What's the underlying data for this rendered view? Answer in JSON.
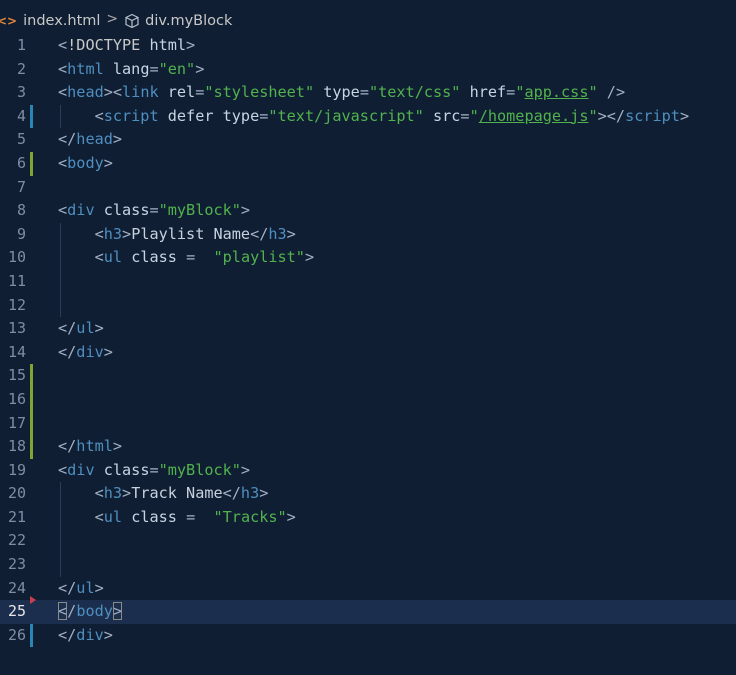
{
  "breadcrumb": {
    "file_icon": "<>",
    "file": "index.html",
    "separator": ">",
    "symbol": "div.myBlock"
  },
  "lines": [
    {
      "n": "1",
      "tokens": [
        [
          "punc",
          "<"
        ],
        [
          "doctype",
          "!DOCTYPE "
        ],
        [
          "attr",
          "html"
        ],
        [
          "punc",
          ">"
        ]
      ]
    },
    {
      "n": "2",
      "tokens": [
        [
          "punc",
          "<"
        ],
        [
          "tag",
          "html"
        ],
        [
          "text",
          " "
        ],
        [
          "attr",
          "lang"
        ],
        [
          "punc",
          "="
        ],
        [
          "str",
          "\"en\""
        ],
        [
          "punc",
          ">"
        ]
      ]
    },
    {
      "n": "3",
      "tokens": [
        [
          "punc",
          "<"
        ],
        [
          "tag",
          "head"
        ],
        [
          "punc",
          "><"
        ],
        [
          "tag",
          "link"
        ],
        [
          "text",
          " "
        ],
        [
          "attr",
          "rel"
        ],
        [
          "punc",
          "="
        ],
        [
          "str",
          "\"stylesheet\""
        ],
        [
          "text",
          " "
        ],
        [
          "attr",
          "type"
        ],
        [
          "punc",
          "="
        ],
        [
          "str",
          "\"text/css\""
        ],
        [
          "text",
          " "
        ],
        [
          "attr",
          "href"
        ],
        [
          "punc",
          "="
        ],
        [
          "str",
          "\""
        ],
        [
          "link",
          "app.css"
        ],
        [
          "str",
          "\""
        ],
        [
          "text",
          " "
        ],
        [
          "punc",
          "/>"
        ]
      ]
    },
    {
      "n": "4",
      "tokens": [
        [
          "text",
          "    "
        ],
        [
          "punc",
          "<"
        ],
        [
          "tag",
          "script"
        ],
        [
          "text",
          " "
        ],
        [
          "attr",
          "defer"
        ],
        [
          "text",
          " "
        ],
        [
          "attr",
          "type"
        ],
        [
          "punc",
          "="
        ],
        [
          "str",
          "\"text/javascript\""
        ],
        [
          "text",
          " "
        ],
        [
          "attr",
          "src"
        ],
        [
          "punc",
          "="
        ],
        [
          "str",
          "\""
        ],
        [
          "link",
          "/homepage.js"
        ],
        [
          "str",
          "\""
        ],
        [
          "punc",
          "></"
        ],
        [
          "tag",
          "script"
        ],
        [
          "punc",
          ">"
        ]
      ]
    },
    {
      "n": "5",
      "tokens": [
        [
          "punc",
          "</"
        ],
        [
          "tag",
          "head"
        ],
        [
          "punc",
          ">"
        ]
      ]
    },
    {
      "n": "6",
      "tokens": [
        [
          "punc",
          "<"
        ],
        [
          "tag",
          "body"
        ],
        [
          "punc",
          ">"
        ]
      ]
    },
    {
      "n": "7",
      "tokens": []
    },
    {
      "n": "8",
      "tokens": [
        [
          "punc",
          "<"
        ],
        [
          "tag",
          "div"
        ],
        [
          "text",
          " "
        ],
        [
          "attr",
          "class"
        ],
        [
          "punc",
          "="
        ],
        [
          "str",
          "\"myBlock\""
        ],
        [
          "punc",
          ">"
        ]
      ]
    },
    {
      "n": "9",
      "tokens": [
        [
          "text",
          "    "
        ],
        [
          "punc",
          "<"
        ],
        [
          "tag",
          "h3"
        ],
        [
          "punc",
          ">"
        ],
        [
          "text",
          "Playlist Name"
        ],
        [
          "punc",
          "</"
        ],
        [
          "tag",
          "h3"
        ],
        [
          "punc",
          ">"
        ]
      ]
    },
    {
      "n": "10",
      "tokens": [
        [
          "text",
          "    "
        ],
        [
          "punc",
          "<"
        ],
        [
          "tag",
          "ul"
        ],
        [
          "text",
          " "
        ],
        [
          "attr",
          "class"
        ],
        [
          "text",
          " "
        ],
        [
          "punc",
          "="
        ],
        [
          "text",
          "  "
        ],
        [
          "str",
          "\"playlist\""
        ],
        [
          "punc",
          ">"
        ]
      ]
    },
    {
      "n": "11",
      "tokens": []
    },
    {
      "n": "12",
      "tokens": []
    },
    {
      "n": "13",
      "tokens": [
        [
          "punc",
          "</"
        ],
        [
          "tag",
          "ul"
        ],
        [
          "punc",
          ">"
        ]
      ]
    },
    {
      "n": "14",
      "tokens": [
        [
          "punc",
          "</"
        ],
        [
          "tag",
          "div"
        ],
        [
          "punc",
          ">"
        ]
      ]
    },
    {
      "n": "15",
      "tokens": []
    },
    {
      "n": "16",
      "tokens": []
    },
    {
      "n": "17",
      "tokens": []
    },
    {
      "n": "18",
      "tokens": [
        [
          "punc",
          "</"
        ],
        [
          "tag",
          "html"
        ],
        [
          "punc",
          ">"
        ]
      ]
    },
    {
      "n": "19",
      "tokens": [
        [
          "punc",
          "<"
        ],
        [
          "tag",
          "div"
        ],
        [
          "text",
          " "
        ],
        [
          "attr",
          "class"
        ],
        [
          "punc",
          "="
        ],
        [
          "str",
          "\"myBlock\""
        ],
        [
          "punc",
          ">"
        ]
      ]
    },
    {
      "n": "20",
      "tokens": [
        [
          "text",
          "    "
        ],
        [
          "punc",
          "<"
        ],
        [
          "tag",
          "h3"
        ],
        [
          "punc",
          ">"
        ],
        [
          "text",
          "Track Name"
        ],
        [
          "punc",
          "</"
        ],
        [
          "tag",
          "h3"
        ],
        [
          "punc",
          ">"
        ]
      ]
    },
    {
      "n": "21",
      "tokens": [
        [
          "text",
          "    "
        ],
        [
          "punc",
          "<"
        ],
        [
          "tag",
          "ul"
        ],
        [
          "text",
          " "
        ],
        [
          "attr",
          "class"
        ],
        [
          "text",
          " "
        ],
        [
          "punc",
          "="
        ],
        [
          "text",
          "  "
        ],
        [
          "str",
          "\"Tracks\""
        ],
        [
          "punc",
          ">"
        ]
      ]
    },
    {
      "n": "22",
      "tokens": []
    },
    {
      "n": "23",
      "tokens": []
    },
    {
      "n": "24",
      "tokens": [
        [
          "punc",
          "</"
        ],
        [
          "tag",
          "ul"
        ],
        [
          "punc",
          ">"
        ]
      ]
    },
    {
      "n": "25",
      "tokens": [
        [
          "boxpunc",
          "<"
        ],
        [
          "punc",
          "/"
        ],
        [
          "tag",
          "body"
        ],
        [
          "boxpunc",
          ">"
        ]
      ]
    },
    {
      "n": "26",
      "tokens": [
        [
          "punc",
          "</"
        ],
        [
          "tag",
          "div"
        ],
        [
          "punc",
          ">"
        ]
      ]
    }
  ],
  "markers": {
    "4": "blue",
    "6": "green",
    "15": "green",
    "16": "green",
    "17": "green",
    "18": "green",
    "25": "red",
    "26": "blue"
  },
  "guides": [
    "4",
    "9",
    "10",
    "11",
    "12",
    "20",
    "21",
    "22",
    "23"
  ],
  "current_line": "25",
  "colors": {
    "background": "#0f1e33",
    "current_line": "#1c2e4e",
    "tag": "#4f8fbf",
    "string": "#52b24d",
    "attribute": "#c7d5e3",
    "gutter_modified": "#2b86b3",
    "gutter_added": "#7ea632",
    "gutter_deleted": "#c63f4f"
  }
}
